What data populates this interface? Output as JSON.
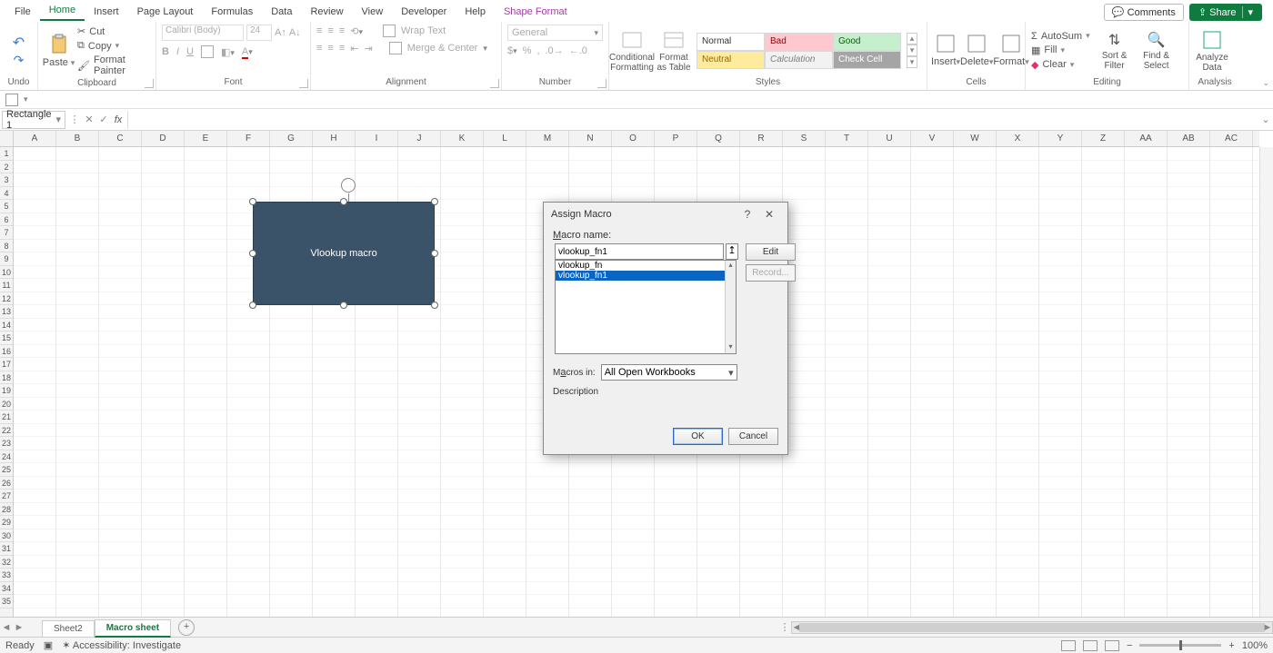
{
  "menu": {
    "items": [
      "File",
      "Home",
      "Insert",
      "Page Layout",
      "Formulas",
      "Data",
      "Review",
      "View",
      "Developer",
      "Help",
      "Shape Format"
    ],
    "active": "Home",
    "context": "Shape Format"
  },
  "top_right": {
    "comments": "Comments",
    "share": "Share"
  },
  "ribbon": {
    "undo": {
      "label": "Undo"
    },
    "clipboard": {
      "label": "Clipboard",
      "paste": "Paste",
      "cut": "Cut",
      "copy": "Copy",
      "fp": "Format Painter"
    },
    "font": {
      "label": "Font",
      "name": "Calibri (Body)",
      "size": "24"
    },
    "alignment": {
      "label": "Alignment",
      "wrap": "Wrap Text",
      "merge": "Merge & Center"
    },
    "number": {
      "label": "Number",
      "format": "General"
    },
    "styles": {
      "label": "Styles",
      "cf": "Conditional Formatting",
      "fat": "Format as Table",
      "gallery": [
        "Normal",
        "Bad",
        "Good",
        "Neutral",
        "Calculation",
        "Check Cell"
      ]
    },
    "cells": {
      "label": "Cells",
      "ins": "Insert",
      "del": "Delete",
      "fmt": "Format"
    },
    "editing": {
      "label": "Editing",
      "autosum": "AutoSum",
      "fill": "Fill",
      "clear": "Clear",
      "sort": "Sort & Filter",
      "find": "Find & Select"
    },
    "analysis": {
      "label": "Analysis",
      "ad": "Analyze Data"
    }
  },
  "namebox": "Rectangle 1",
  "shape_text": "Vlookup macro",
  "grid": {
    "cols": [
      "A",
      "B",
      "C",
      "D",
      "E",
      "F",
      "G",
      "H",
      "I",
      "J",
      "K",
      "L",
      "M",
      "N",
      "O",
      "P",
      "Q",
      "R",
      "S",
      "T",
      "U",
      "V",
      "W",
      "X",
      "Y",
      "Z",
      "AA",
      "AB",
      "AC"
    ],
    "rows": 35
  },
  "dialog": {
    "title": "Assign Macro",
    "macro_name_lbl": "Macro name:",
    "macro_name_val": "vlookup_fn1",
    "list": [
      "vlookup_fn",
      "vlookup_fn1"
    ],
    "selected": "vlookup_fn1",
    "macros_in_lbl": "Macros in:",
    "macros_in_val": "All Open Workbooks",
    "desc_lbl": "Description",
    "edit": "Edit",
    "record": "Record...",
    "ok": "OK",
    "cancel": "Cancel"
  },
  "sheets": {
    "tabs": [
      "Sheet2",
      "Macro sheet"
    ],
    "active": "Macro sheet"
  },
  "status": {
    "ready": "Ready",
    "acc": "Accessibility: Investigate",
    "zoom": "100%"
  }
}
